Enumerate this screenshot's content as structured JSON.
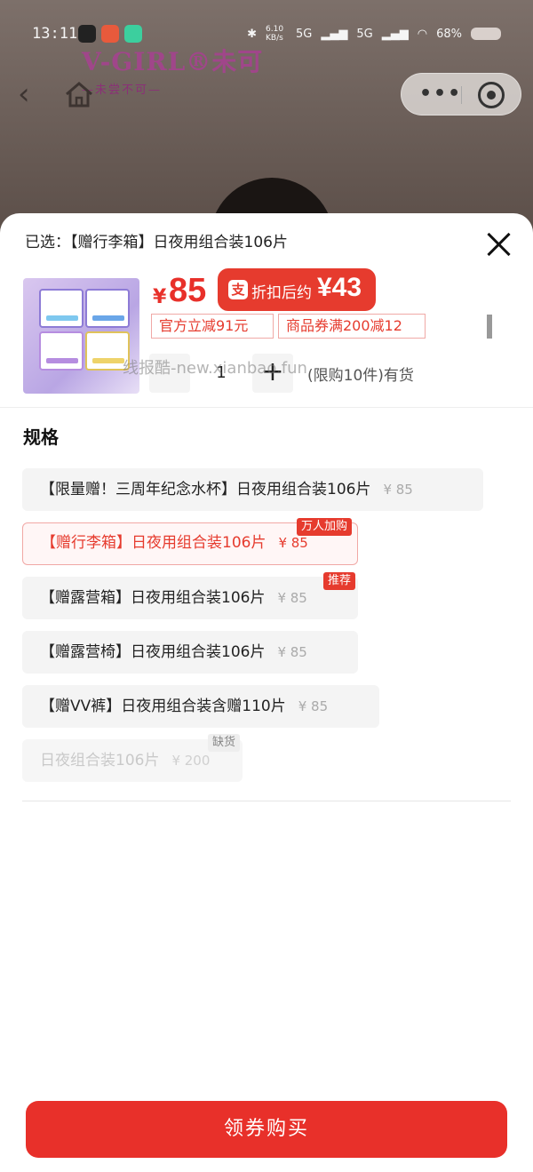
{
  "status_bar": {
    "time": "13:11",
    "net_speed": "6.10 KB/s",
    "signal1": "5G",
    "signal2": "5G",
    "battery": "68%"
  },
  "header": {
    "logo_text": "V-GIRL®未可",
    "logo_sub": "—未尝不可—"
  },
  "sheet": {
    "selected_label": "已选：【赠行李箱】日夜用组合装106片",
    "price_currency": "¥",
    "price_value": "85",
    "after_discount_icon": "支",
    "after_discount_label": "折扣后约",
    "after_discount_price": "¥43",
    "coupons": [
      "官方立减91元",
      "商品券满200减12"
    ],
    "quantity": "1",
    "plus_symbol": "+",
    "stock_text": "(限购10件)有货",
    "watermark": "线报酷-new.xianbao.fun",
    "spec_title": "规格",
    "specs": [
      {
        "label": "【限量赠！三周年纪念水杯】日夜用组合装106片",
        "price": "¥ 85",
        "tag": ""
      },
      {
        "label": "【赠行李箱】日夜用组合装106片",
        "price": "¥ 85",
        "tag": "万人加购"
      },
      {
        "label": "【赠露营箱】日夜用组合装106片",
        "price": "¥ 85",
        "tag": "推荐"
      },
      {
        "label": "【赠露营椅】日夜用组合装106片",
        "price": "¥ 85",
        "tag": ""
      },
      {
        "label": "【赠VV裤】日夜用组合装含赠110片",
        "price": "¥ 85",
        "tag": ""
      },
      {
        "label": "日夜组合装106片",
        "price": "¥ 200",
        "tag": "缺货"
      }
    ],
    "buy_button": "领券购买"
  }
}
